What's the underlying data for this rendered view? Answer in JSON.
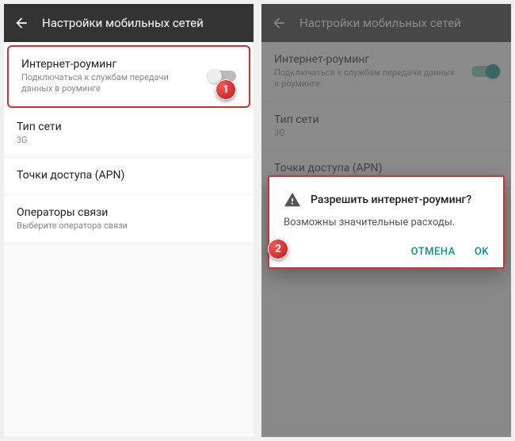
{
  "header": {
    "title": "Настройки мобильных сетей"
  },
  "items": {
    "roaming": {
      "title": "Интернет-роуминг",
      "sub": "Подключаться к службам передачи данных в роуминге"
    },
    "nettype": {
      "title": "Тип сети",
      "sub": "3G"
    },
    "apn": {
      "title": "Точки доступа (APN)"
    },
    "ops": {
      "title": "Операторы связи",
      "sub": "Выберите оператора связи"
    }
  },
  "dialog": {
    "title": "Разрешить интернет-роуминг?",
    "body": "Возможны значительные расходы.",
    "cancel": "ОТМЕНА",
    "ok": "OK"
  },
  "badges": {
    "b1": "1",
    "b2": "2"
  }
}
